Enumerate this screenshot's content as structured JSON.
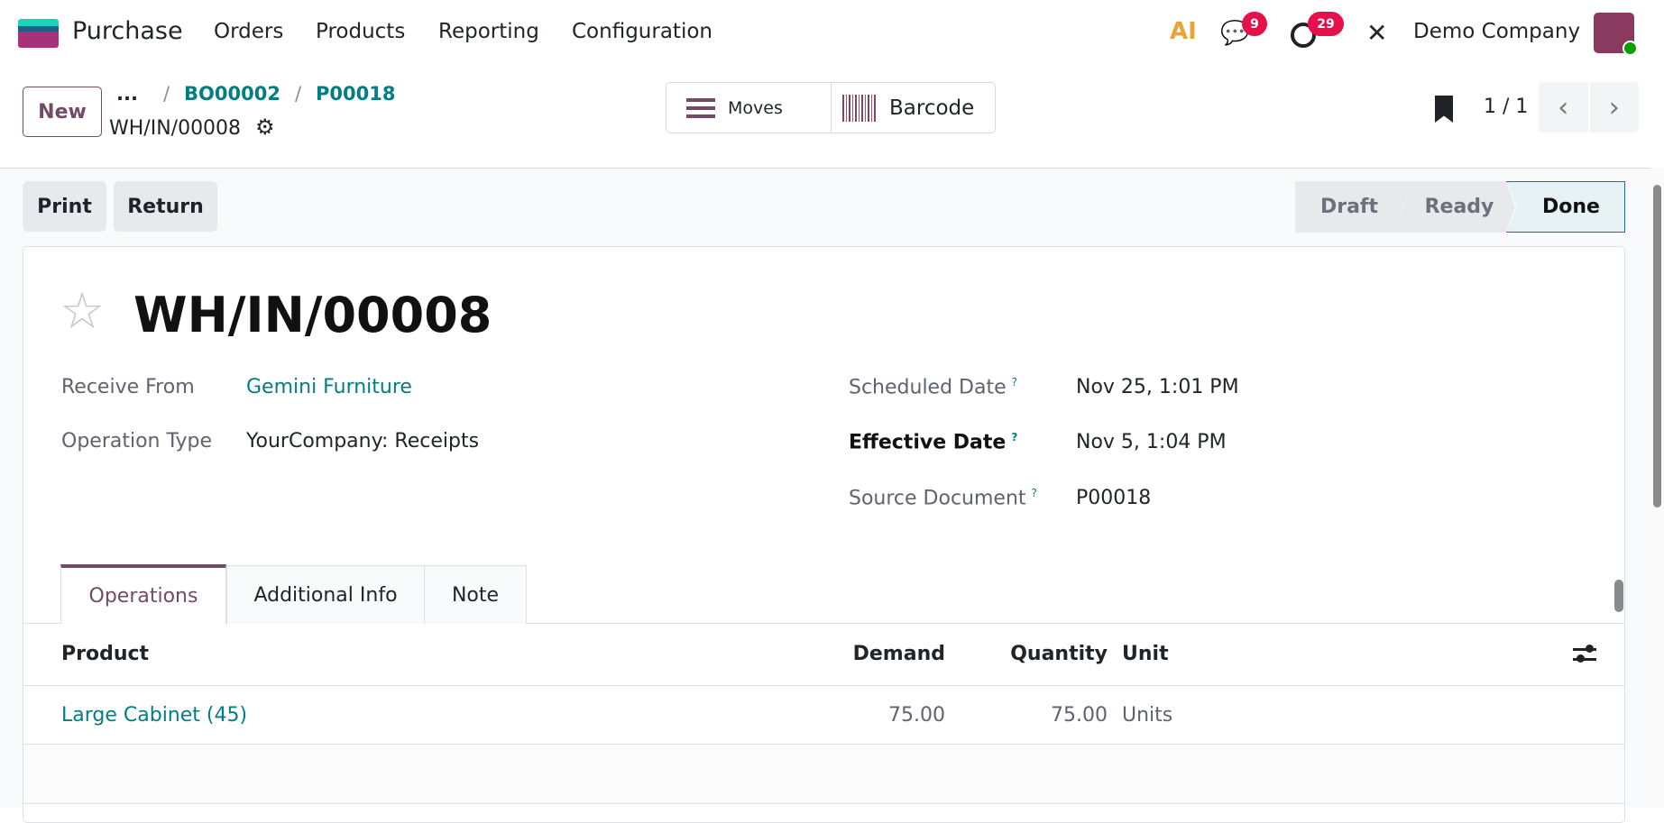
{
  "navbar": {
    "app_name": "Purchase",
    "menu": [
      "Orders",
      "Products",
      "Reporting",
      "Configuration"
    ],
    "ai_label": "AI",
    "messages_count": "9",
    "activities_count": "29",
    "company": "Demo Company"
  },
  "control": {
    "new_label": "New",
    "breadcrumb_more": "...",
    "breadcrumbs": [
      "BO00002",
      "P00018"
    ],
    "current": "WH/IN/00008",
    "moves_label": "Moves",
    "barcode_label": "Barcode",
    "pager": "1 / 1"
  },
  "actions": {
    "print": "Print",
    "return": "Return"
  },
  "status": {
    "stages": [
      "Draft",
      "Ready",
      "Done"
    ],
    "current": "Done"
  },
  "form": {
    "title": "WH/IN/00008",
    "left": [
      {
        "label": "Receive From",
        "value": "Gemini Furniture"
      },
      {
        "label": "Operation Type",
        "value": "YourCompany: Receipts"
      }
    ],
    "right": [
      {
        "label": "Scheduled Date",
        "value": "Nov 25, 1:01 PM"
      },
      {
        "label": "Effective Date",
        "value": "Nov 5, 1:04 PM"
      },
      {
        "label": "Source Document",
        "value": "P00018"
      }
    ],
    "help": "?"
  },
  "tabs": [
    "Operations",
    "Additional Info",
    "Note"
  ],
  "table": {
    "headers": {
      "product": "Product",
      "demand": "Demand",
      "quantity": "Quantity",
      "unit": "Unit"
    },
    "rows": [
      {
        "product": "Large Cabinet (45)",
        "demand": "75.00",
        "quantity": "75.00",
        "unit": "Units"
      }
    ]
  },
  "colors": {
    "primary": "#714b67",
    "link": "#017e84",
    "badge": "#e6104a"
  }
}
